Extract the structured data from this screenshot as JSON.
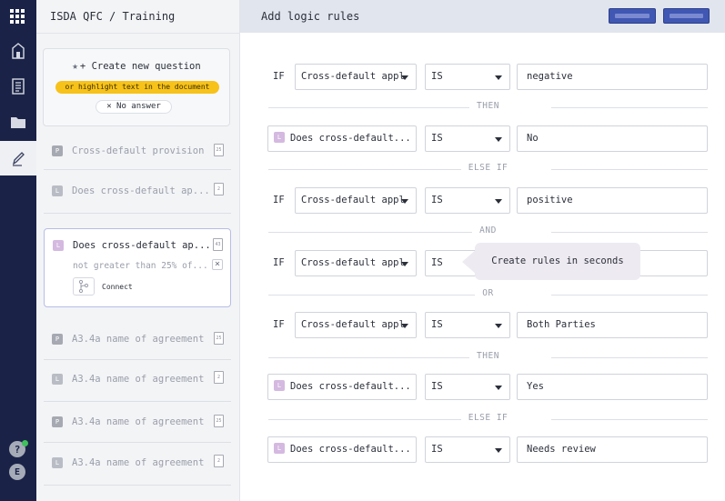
{
  "sidebar_rail": {
    "icons": [
      "apps-grid-icon",
      "home-icon",
      "document-icon",
      "folder-icon",
      "edit-icon"
    ],
    "help_label": "?",
    "avatar_initial": "E"
  },
  "panel": {
    "title": "ISDA QFC / Training",
    "create": {
      "title": "+ Create new question",
      "highlight_hint": "or highlight text in the document",
      "no_answer": "No answer"
    },
    "questions": [
      {
        "type": "P",
        "label": "Cross-default provision",
        "doc": "25"
      },
      {
        "type": "L",
        "label": "Does cross-default ap...",
        "doc": "2"
      },
      {
        "type": "L",
        "label": "Does cross-default ap...",
        "doc": "43",
        "active": true,
        "subtitle": "not greater than 25% of...",
        "connect": "Connect"
      },
      {
        "type": "P",
        "label": "A3.4a name of agreement",
        "doc": "25"
      },
      {
        "type": "L",
        "label": "A3.4a name of agreement",
        "doc": "2"
      },
      {
        "type": "P",
        "label": "A3.4a name of agreement",
        "doc": "25"
      },
      {
        "type": "L",
        "label": "A3.4a name of agreement",
        "doc": "2"
      }
    ]
  },
  "main": {
    "title": "Add logic rules",
    "rules": [
      {
        "kw": "IF",
        "field": "Cross-default appl",
        "op": "IS",
        "value": "negative"
      },
      {
        "sep": "THEN"
      },
      {
        "kw": "L",
        "field": "Does cross-default...",
        "op": "IS",
        "value": "No"
      },
      {
        "sep": "ELSE IF"
      },
      {
        "kw": "IF",
        "field": "Cross-default appl",
        "op": "IS",
        "value": "positive"
      },
      {
        "sep": "AND"
      },
      {
        "kw": "IF",
        "field": "Cross-default appl",
        "op": "IS",
        "value": ""
      },
      {
        "sep": "OR"
      },
      {
        "kw": "IF",
        "field": "Cross-default appl",
        "op": "IS",
        "value": "Both Parties"
      },
      {
        "sep": "THEN"
      },
      {
        "kw": "L",
        "field": "Does cross-default...",
        "op": "IS",
        "value": "Yes"
      },
      {
        "sep": "ELSE IF"
      },
      {
        "kw": "L",
        "field": "Does cross-default...",
        "op": "IS",
        "value": "Needs review"
      }
    ],
    "tooltip": "Create rules in seconds"
  },
  "colors": {
    "rail": "#1a2347",
    "accent": "#4057b3",
    "highlight": "#f7c21a",
    "logic_badge": "#d4b9e0"
  }
}
